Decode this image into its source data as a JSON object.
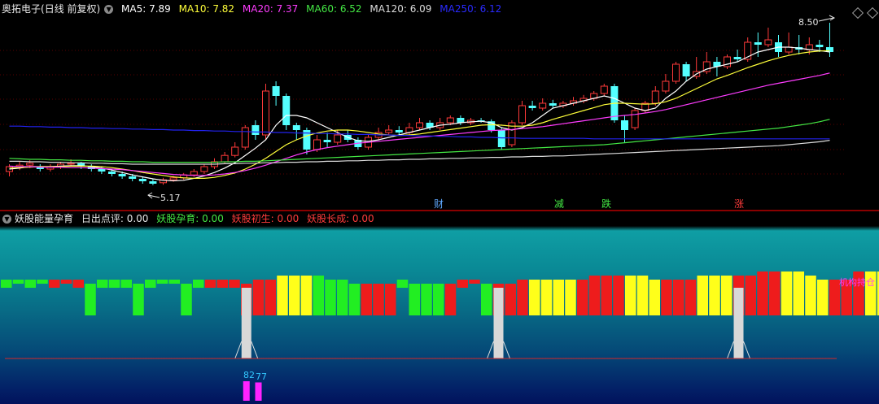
{
  "top_header": {
    "title": "奥拓电子",
    "period": "(日线 前复权)",
    "ma": [
      {
        "label": "MA5: 7.89",
        "color": "#ffffff"
      },
      {
        "label": "MA10: 7.82",
        "color": "#ffff3a"
      },
      {
        "label": "MA20: 7.37",
        "color": "#ff3cff"
      },
      {
        "label": "MA60: 6.52",
        "color": "#44e844"
      },
      {
        "label": "MA120: 6.09",
        "color": "#dcdcdc"
      },
      {
        "label": "MA250: 6.12",
        "color": "#2222ee"
      }
    ]
  },
  "price_chart": {
    "high_label": "8.50",
    "low_label": "5.17",
    "event_markers": [
      {
        "label": "财",
        "color": "#5fa8ff"
      },
      {
        "label": "减",
        "color": "#44e844"
      },
      {
        "label": "跌",
        "color": "#44e844"
      },
      {
        "label": "涨",
        "color": "#ff3a3a"
      }
    ]
  },
  "bottom_header": {
    "title": "妖股能量孕育",
    "items": [
      {
        "label": "日出点评: 0.00",
        "color": "#e6e6e6"
      },
      {
        "label": "妖股孕育: 0.00",
        "color": "#44e844"
      },
      {
        "label": "妖股初生: 0.00",
        "color": "#ff3c3c"
      },
      {
        "label": "妖股长成: 0.00",
        "color": "#ff3c3c"
      }
    ]
  },
  "indicator": {
    "side_label": "机构持仓",
    "value_labels": [
      {
        "label": "82",
        "color": "#33c7ff"
      },
      {
        "label": "77",
        "color": "#33c7ff"
      }
    ]
  },
  "chart_data": {
    "type": "candlestick",
    "y_range": [
      5.0,
      8.6
    ],
    "candles": [
      [
        5.45,
        5.55,
        5.35,
        5.6
      ],
      [
        5.55,
        5.58,
        5.48,
        5.65
      ],
      [
        5.58,
        5.62,
        5.52,
        5.68
      ],
      [
        5.55,
        5.5,
        5.45,
        5.6
      ],
      [
        5.5,
        5.55,
        5.45,
        5.6
      ],
      [
        5.55,
        5.6,
        5.5,
        5.65
      ],
      [
        5.6,
        5.62,
        5.55,
        5.7
      ],
      [
        5.62,
        5.55,
        5.5,
        5.65
      ],
      [
        5.55,
        5.5,
        5.45,
        5.6
      ],
      [
        5.5,
        5.45,
        5.4,
        5.55
      ],
      [
        5.45,
        5.4,
        5.35,
        5.5
      ],
      [
        5.4,
        5.35,
        5.3,
        5.45
      ],
      [
        5.35,
        5.3,
        5.25,
        5.4
      ],
      [
        5.3,
        5.25,
        5.2,
        5.35
      ],
      [
        5.25,
        5.2,
        5.17,
        5.3
      ],
      [
        5.22,
        5.28,
        5.18,
        5.32
      ],
      [
        5.28,
        5.32,
        5.24,
        5.36
      ],
      [
        5.32,
        5.38,
        5.28,
        5.42
      ],
      [
        5.38,
        5.45,
        5.34,
        5.5
      ],
      [
        5.45,
        5.55,
        5.4,
        5.6
      ],
      [
        5.55,
        5.65,
        5.5,
        5.72
      ],
      [
        5.65,
        5.78,
        5.6,
        5.85
      ],
      [
        5.78,
        5.95,
        5.74,
        6.05
      ],
      [
        5.95,
        6.35,
        5.9,
        6.4
      ],
      [
        6.4,
        6.2,
        6.1,
        6.5
      ],
      [
        6.2,
        7.1,
        6.1,
        7.25
      ],
      [
        7.2,
        7.0,
        6.8,
        7.3
      ],
      [
        7.0,
        6.4,
        6.3,
        7.05
      ],
      [
        6.4,
        6.3,
        6.1,
        6.45
      ],
      [
        6.3,
        5.9,
        5.8,
        6.35
      ],
      [
        5.9,
        6.1,
        5.85,
        6.2
      ],
      [
        6.1,
        6.05,
        5.95,
        6.25
      ],
      [
        6.05,
        6.2,
        6.0,
        6.3
      ],
      [
        6.2,
        6.1,
        6.05,
        6.3
      ],
      [
        6.1,
        5.95,
        5.9,
        6.15
      ],
      [
        5.95,
        6.15,
        5.9,
        6.2
      ],
      [
        6.15,
        6.25,
        6.1,
        6.35
      ],
      [
        6.25,
        6.3,
        6.2,
        6.4
      ],
      [
        6.3,
        6.25,
        6.2,
        6.38
      ],
      [
        6.25,
        6.35,
        6.2,
        6.45
      ],
      [
        6.35,
        6.45,
        6.3,
        6.55
      ],
      [
        6.45,
        6.35,
        6.3,
        6.5
      ],
      [
        6.35,
        6.45,
        6.3,
        6.55
      ],
      [
        6.45,
        6.55,
        6.4,
        6.6
      ],
      [
        6.55,
        6.45,
        6.4,
        6.6
      ],
      [
        6.45,
        6.5,
        6.4,
        6.55
      ],
      [
        6.5,
        6.48,
        6.45,
        6.55
      ],
      [
        6.48,
        6.3,
        6.25,
        6.52
      ],
      [
        6.3,
        5.95,
        5.9,
        6.35
      ],
      [
        6.0,
        6.45,
        5.95,
        6.5
      ],
      [
        6.45,
        6.8,
        6.4,
        6.9
      ],
      [
        6.8,
        6.75,
        6.7,
        6.9
      ],
      [
        6.75,
        6.85,
        6.7,
        6.95
      ],
      [
        6.85,
        6.8,
        6.75,
        6.92
      ],
      [
        6.8,
        6.85,
        6.75,
        6.9
      ],
      [
        6.85,
        6.9,
        6.8,
        6.98
      ],
      [
        6.9,
        6.95,
        6.85,
        7.02
      ],
      [
        6.95,
        7.05,
        6.9,
        7.1
      ],
      [
        7.05,
        7.2,
        7.0,
        7.25
      ],
      [
        7.2,
        6.5,
        6.45,
        7.25
      ],
      [
        6.5,
        6.3,
        6.05,
        6.6
      ],
      [
        6.35,
        6.7,
        6.3,
        6.75
      ],
      [
        6.7,
        6.85,
        6.65,
        6.9
      ],
      [
        6.85,
        7.1,
        6.8,
        7.2
      ],
      [
        7.1,
        7.3,
        7.05,
        7.45
      ],
      [
        7.3,
        7.65,
        7.25,
        7.7
      ],
      [
        7.65,
        7.4,
        7.3,
        7.7
      ],
      [
        7.4,
        7.5,
        7.35,
        7.8
      ],
      [
        7.5,
        7.7,
        7.45,
        7.9
      ],
      [
        7.7,
        7.6,
        7.4,
        7.8
      ],
      [
        7.6,
        7.8,
        7.55,
        7.85
      ],
      [
        7.8,
        7.75,
        7.7,
        7.95
      ],
      [
        7.75,
        8.1,
        7.7,
        8.2
      ],
      [
        8.1,
        8.05,
        7.8,
        8.3
      ],
      [
        8.05,
        8.15,
        8.0,
        8.4
      ],
      [
        8.1,
        7.9,
        7.8,
        8.25
      ],
      [
        7.9,
        8.0,
        7.85,
        8.3
      ],
      [
        8.0,
        7.95,
        7.85,
        8.25
      ],
      [
        7.95,
        8.05,
        7.85,
        8.2
      ],
      [
        8.05,
        8.0,
        7.9,
        8.15
      ],
      [
        8.0,
        7.9,
        7.8,
        8.5
      ]
    ],
    "ma_series": [
      {
        "name": "MA5",
        "color": "#ffffff",
        "values": [
          5.5,
          5.52,
          5.55,
          5.55,
          5.55,
          5.56,
          5.57,
          5.57,
          5.55,
          5.52,
          5.48,
          5.43,
          5.38,
          5.34,
          5.3,
          5.27,
          5.26,
          5.27,
          5.31,
          5.36,
          5.43,
          5.52,
          5.63,
          5.78,
          5.93,
          6.1,
          6.4,
          6.6,
          6.6,
          6.55,
          6.45,
          6.35,
          6.25,
          6.15,
          6.08,
          6.07,
          6.1,
          6.15,
          6.2,
          6.25,
          6.3,
          6.35,
          6.4,
          6.42,
          6.45,
          6.47,
          6.48,
          6.45,
          6.35,
          6.3,
          6.35,
          6.45,
          6.6,
          6.75,
          6.8,
          6.85,
          6.9,
          6.95,
          7.0,
          6.95,
          6.85,
          6.75,
          6.7,
          6.75,
          6.95,
          7.1,
          7.3,
          7.45,
          7.55,
          7.6,
          7.65,
          7.7,
          7.8,
          7.9,
          7.95,
          8.0,
          8.0,
          7.98,
          7.95,
          7.93,
          7.9
        ]
      },
      {
        "name": "MA10",
        "color": "#ffff3a",
        "values": [
          5.52,
          5.53,
          5.54,
          5.55,
          5.55,
          5.55,
          5.56,
          5.56,
          5.56,
          5.55,
          5.53,
          5.5,
          5.47,
          5.43,
          5.4,
          5.37,
          5.34,
          5.32,
          5.31,
          5.31,
          5.33,
          5.37,
          5.42,
          5.5,
          5.6,
          5.72,
          5.86,
          6.0,
          6.1,
          6.18,
          6.24,
          6.28,
          6.3,
          6.3,
          6.28,
          6.25,
          6.22,
          6.2,
          6.19,
          6.2,
          6.22,
          6.25,
          6.28,
          6.31,
          6.34,
          6.37,
          6.4,
          6.41,
          6.4,
          6.38,
          6.38,
          6.4,
          6.45,
          6.52,
          6.58,
          6.64,
          6.7,
          6.76,
          6.82,
          6.85,
          6.85,
          6.84,
          6.83,
          6.84,
          6.88,
          6.95,
          7.05,
          7.15,
          7.25,
          7.35,
          7.42,
          7.5,
          7.58,
          7.65,
          7.72,
          7.78,
          7.83,
          7.87,
          7.9,
          7.92,
          7.93
        ]
      },
      {
        "name": "MA20",
        "color": "#ff3cff",
        "values": [
          5.56,
          5.55,
          5.55,
          5.54,
          5.54,
          5.54,
          5.53,
          5.53,
          5.52,
          5.51,
          5.5,
          5.49,
          5.47,
          5.45,
          5.43,
          5.41,
          5.39,
          5.38,
          5.37,
          5.37,
          5.38,
          5.4,
          5.43,
          5.47,
          5.52,
          5.58,
          5.65,
          5.72,
          5.79,
          5.85,
          5.9,
          5.94,
          5.97,
          6.0,
          6.03,
          6.05,
          6.07,
          6.09,
          6.11,
          6.13,
          6.15,
          6.17,
          6.19,
          6.21,
          6.23,
          6.25,
          6.27,
          6.29,
          6.3,
          6.31,
          6.33,
          6.35,
          6.37,
          6.4,
          6.43,
          6.46,
          6.49,
          6.52,
          6.55,
          6.58,
          6.6,
          6.62,
          6.65,
          6.68,
          6.72,
          6.77,
          6.82,
          6.87,
          6.92,
          6.97,
          7.02,
          7.07,
          7.12,
          7.17,
          7.22,
          7.26,
          7.3,
          7.34,
          7.38,
          7.42,
          7.47
        ]
      },
      {
        "name": "MA60",
        "color": "#44e844",
        "values": [
          5.72,
          5.71,
          5.7,
          5.7,
          5.69,
          5.69,
          5.68,
          5.68,
          5.67,
          5.67,
          5.66,
          5.66,
          5.65,
          5.65,
          5.64,
          5.64,
          5.64,
          5.64,
          5.64,
          5.64,
          5.64,
          5.65,
          5.65,
          5.66,
          5.66,
          5.67,
          5.68,
          5.69,
          5.7,
          5.71,
          5.72,
          5.73,
          5.74,
          5.75,
          5.76,
          5.77,
          5.78,
          5.79,
          5.8,
          5.81,
          5.82,
          5.83,
          5.84,
          5.85,
          5.86,
          5.87,
          5.88,
          5.89,
          5.9,
          5.91,
          5.92,
          5.93,
          5.94,
          5.95,
          5.96,
          5.97,
          5.98,
          5.99,
          6.0,
          6.02,
          6.04,
          6.06,
          6.08,
          6.1,
          6.12,
          6.14,
          6.16,
          6.18,
          6.2,
          6.22,
          6.24,
          6.26,
          6.28,
          6.3,
          6.32,
          6.34,
          6.37,
          6.4,
          6.43,
          6.47,
          6.52
        ]
      },
      {
        "name": "MA120",
        "color": "#dcdcdc",
        "values": [
          5.66,
          5.66,
          5.65,
          5.65,
          5.64,
          5.64,
          5.63,
          5.63,
          5.62,
          5.62,
          5.61,
          5.61,
          5.6,
          5.6,
          5.6,
          5.6,
          5.6,
          5.6,
          5.6,
          5.6,
          5.6,
          5.61,
          5.61,
          5.62,
          5.62,
          5.63,
          5.63,
          5.64,
          5.64,
          5.65,
          5.65,
          5.66,
          5.66,
          5.67,
          5.67,
          5.68,
          5.68,
          5.69,
          5.69,
          5.7,
          5.7,
          5.71,
          5.71,
          5.72,
          5.72,
          5.73,
          5.73,
          5.74,
          5.74,
          5.75,
          5.75,
          5.76,
          5.76,
          5.77,
          5.77,
          5.78,
          5.79,
          5.8,
          5.81,
          5.82,
          5.83,
          5.84,
          5.85,
          5.86,
          5.87,
          5.88,
          5.89,
          5.9,
          5.91,
          5.92,
          5.93,
          5.94,
          5.95,
          5.96,
          5.97,
          5.98,
          6.0,
          6.02,
          6.04,
          6.06,
          6.09
        ]
      },
      {
        "name": "MA250",
        "color": "#2222ee",
        "values": [
          6.38,
          6.38,
          6.37,
          6.37,
          6.36,
          6.36,
          6.35,
          6.35,
          6.34,
          6.34,
          6.33,
          6.33,
          6.32,
          6.32,
          6.31,
          6.31,
          6.3,
          6.3,
          6.29,
          6.29,
          6.28,
          6.28,
          6.27,
          6.27,
          6.26,
          6.26,
          6.25,
          6.25,
          6.24,
          6.24,
          6.23,
          6.23,
          6.22,
          6.22,
          6.21,
          6.21,
          6.2,
          6.2,
          6.19,
          6.19,
          6.18,
          6.18,
          6.17,
          6.17,
          6.16,
          6.16,
          6.15,
          6.15,
          6.14,
          6.14,
          6.13,
          6.13,
          6.13,
          6.13,
          6.13,
          6.13,
          6.13,
          6.12,
          6.12,
          6.12,
          6.12,
          6.12,
          6.12,
          6.12,
          6.12,
          6.12,
          6.12,
          6.12,
          6.12,
          6.12,
          6.12,
          6.12,
          6.12,
          6.12,
          6.12,
          6.12,
          6.12,
          6.12,
          6.12,
          6.12,
          6.12
        ]
      }
    ],
    "indicator_bars": {
      "bar_levels": [
        1,
        0.5,
        1,
        0.5,
        1,
        0.5,
        1,
        2,
        1,
        1,
        1,
        2,
        1,
        0.5,
        0,
        2,
        1,
        1,
        1,
        1,
        2,
        3,
        3,
        4,
        4,
        4,
        4,
        3,
        3,
        2,
        2,
        2,
        2,
        1,
        2,
        2,
        2,
        2,
        1,
        0,
        2,
        2,
        2,
        3,
        3,
        3,
        3,
        3,
        3,
        4,
        4,
        4,
        4,
        4,
        3,
        3,
        3,
        3,
        4,
        4,
        4,
        4,
        4,
        5,
        5,
        5,
        5,
        4,
        3,
        3,
        3,
        5,
        5,
        5,
        4,
        4,
        2,
        2,
        2,
        1,
        3
      ],
      "bar_colors": [
        "#22ee22",
        "#22ee22",
        "#22ee22",
        "#22ee22",
        "#ee1c1c",
        "#ee1c1c",
        "#ee1c1c",
        "#22ee22",
        "#22ee22",
        "#22ee22",
        "#22ee22",
        "#22ee22",
        "#22ee22",
        "#22ee22",
        "#22ee22",
        "#22ee22",
        "#22ee22",
        "#ee1c1c",
        "#ee1c1c",
        "#ee1c1c",
        "#ee1c1c",
        "#ee1c1c",
        "#ee1c1c",
        "#ffff1a",
        "#ffff1a",
        "#ffff1a",
        "#22ee22",
        "#22ee22",
        "#22ee22",
        "#22ee22",
        "#ee1c1c",
        "#ee1c1c",
        "#ee1c1c",
        "#22ee22",
        "#22ee22",
        "#22ee22",
        "#22ee22",
        "#ee1c1c",
        "#ee1c1c",
        "#ee1c1c",
        "#22ee22",
        "#ee1c1c",
        "#ee1c1c",
        "#ee1c1c",
        "#ffff1a",
        "#ffff1a",
        "#ffff1a",
        "#ffff1a",
        "#ee1c1c",
        "#ee1c1c",
        "#ee1c1c",
        "#ee1c1c",
        "#ffff1a",
        "#ffff1a",
        "#ffff1a",
        "#ee1c1c",
        "#ee1c1c",
        "#ee1c1c",
        "#ffff1a",
        "#ffff1a",
        "#ffff1a",
        "#ee1c1c",
        "#ee1c1c",
        "#ee1c1c",
        "#ee1c1c",
        "#ffff1a",
        "#ffff1a",
        "#ffff1a",
        "#ffff1a",
        "#ee1c1c",
        "#ee1c1c",
        "#ee1c1c",
        "#ffff1a",
        "#ffff1a",
        "#22ee22",
        "#22ee22",
        "#22ee22",
        "#22ee22",
        "#22ee22",
        "#22ee22",
        "#22ee22"
      ],
      "signal_indices": [
        20,
        41,
        61
      ],
      "magenta_indices": [
        20,
        21
      ],
      "magenta_values": [
        82,
        77
      ]
    }
  }
}
